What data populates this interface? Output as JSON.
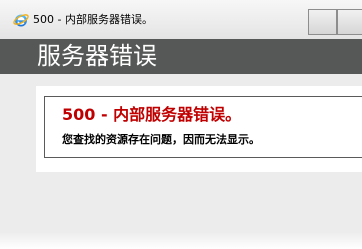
{
  "window": {
    "tab_title": "500 - 内部服务器错误。",
    "browser_icon": "internet-explorer-icon"
  },
  "header": {
    "title": "服务器错误"
  },
  "error": {
    "title": "500 - 内部服务器错误。",
    "message": "您查找的资源存在问题，因而无法显示。"
  },
  "colors": {
    "header_background": "#555856",
    "error_title": "#c00000",
    "page_background": "#ececec"
  }
}
